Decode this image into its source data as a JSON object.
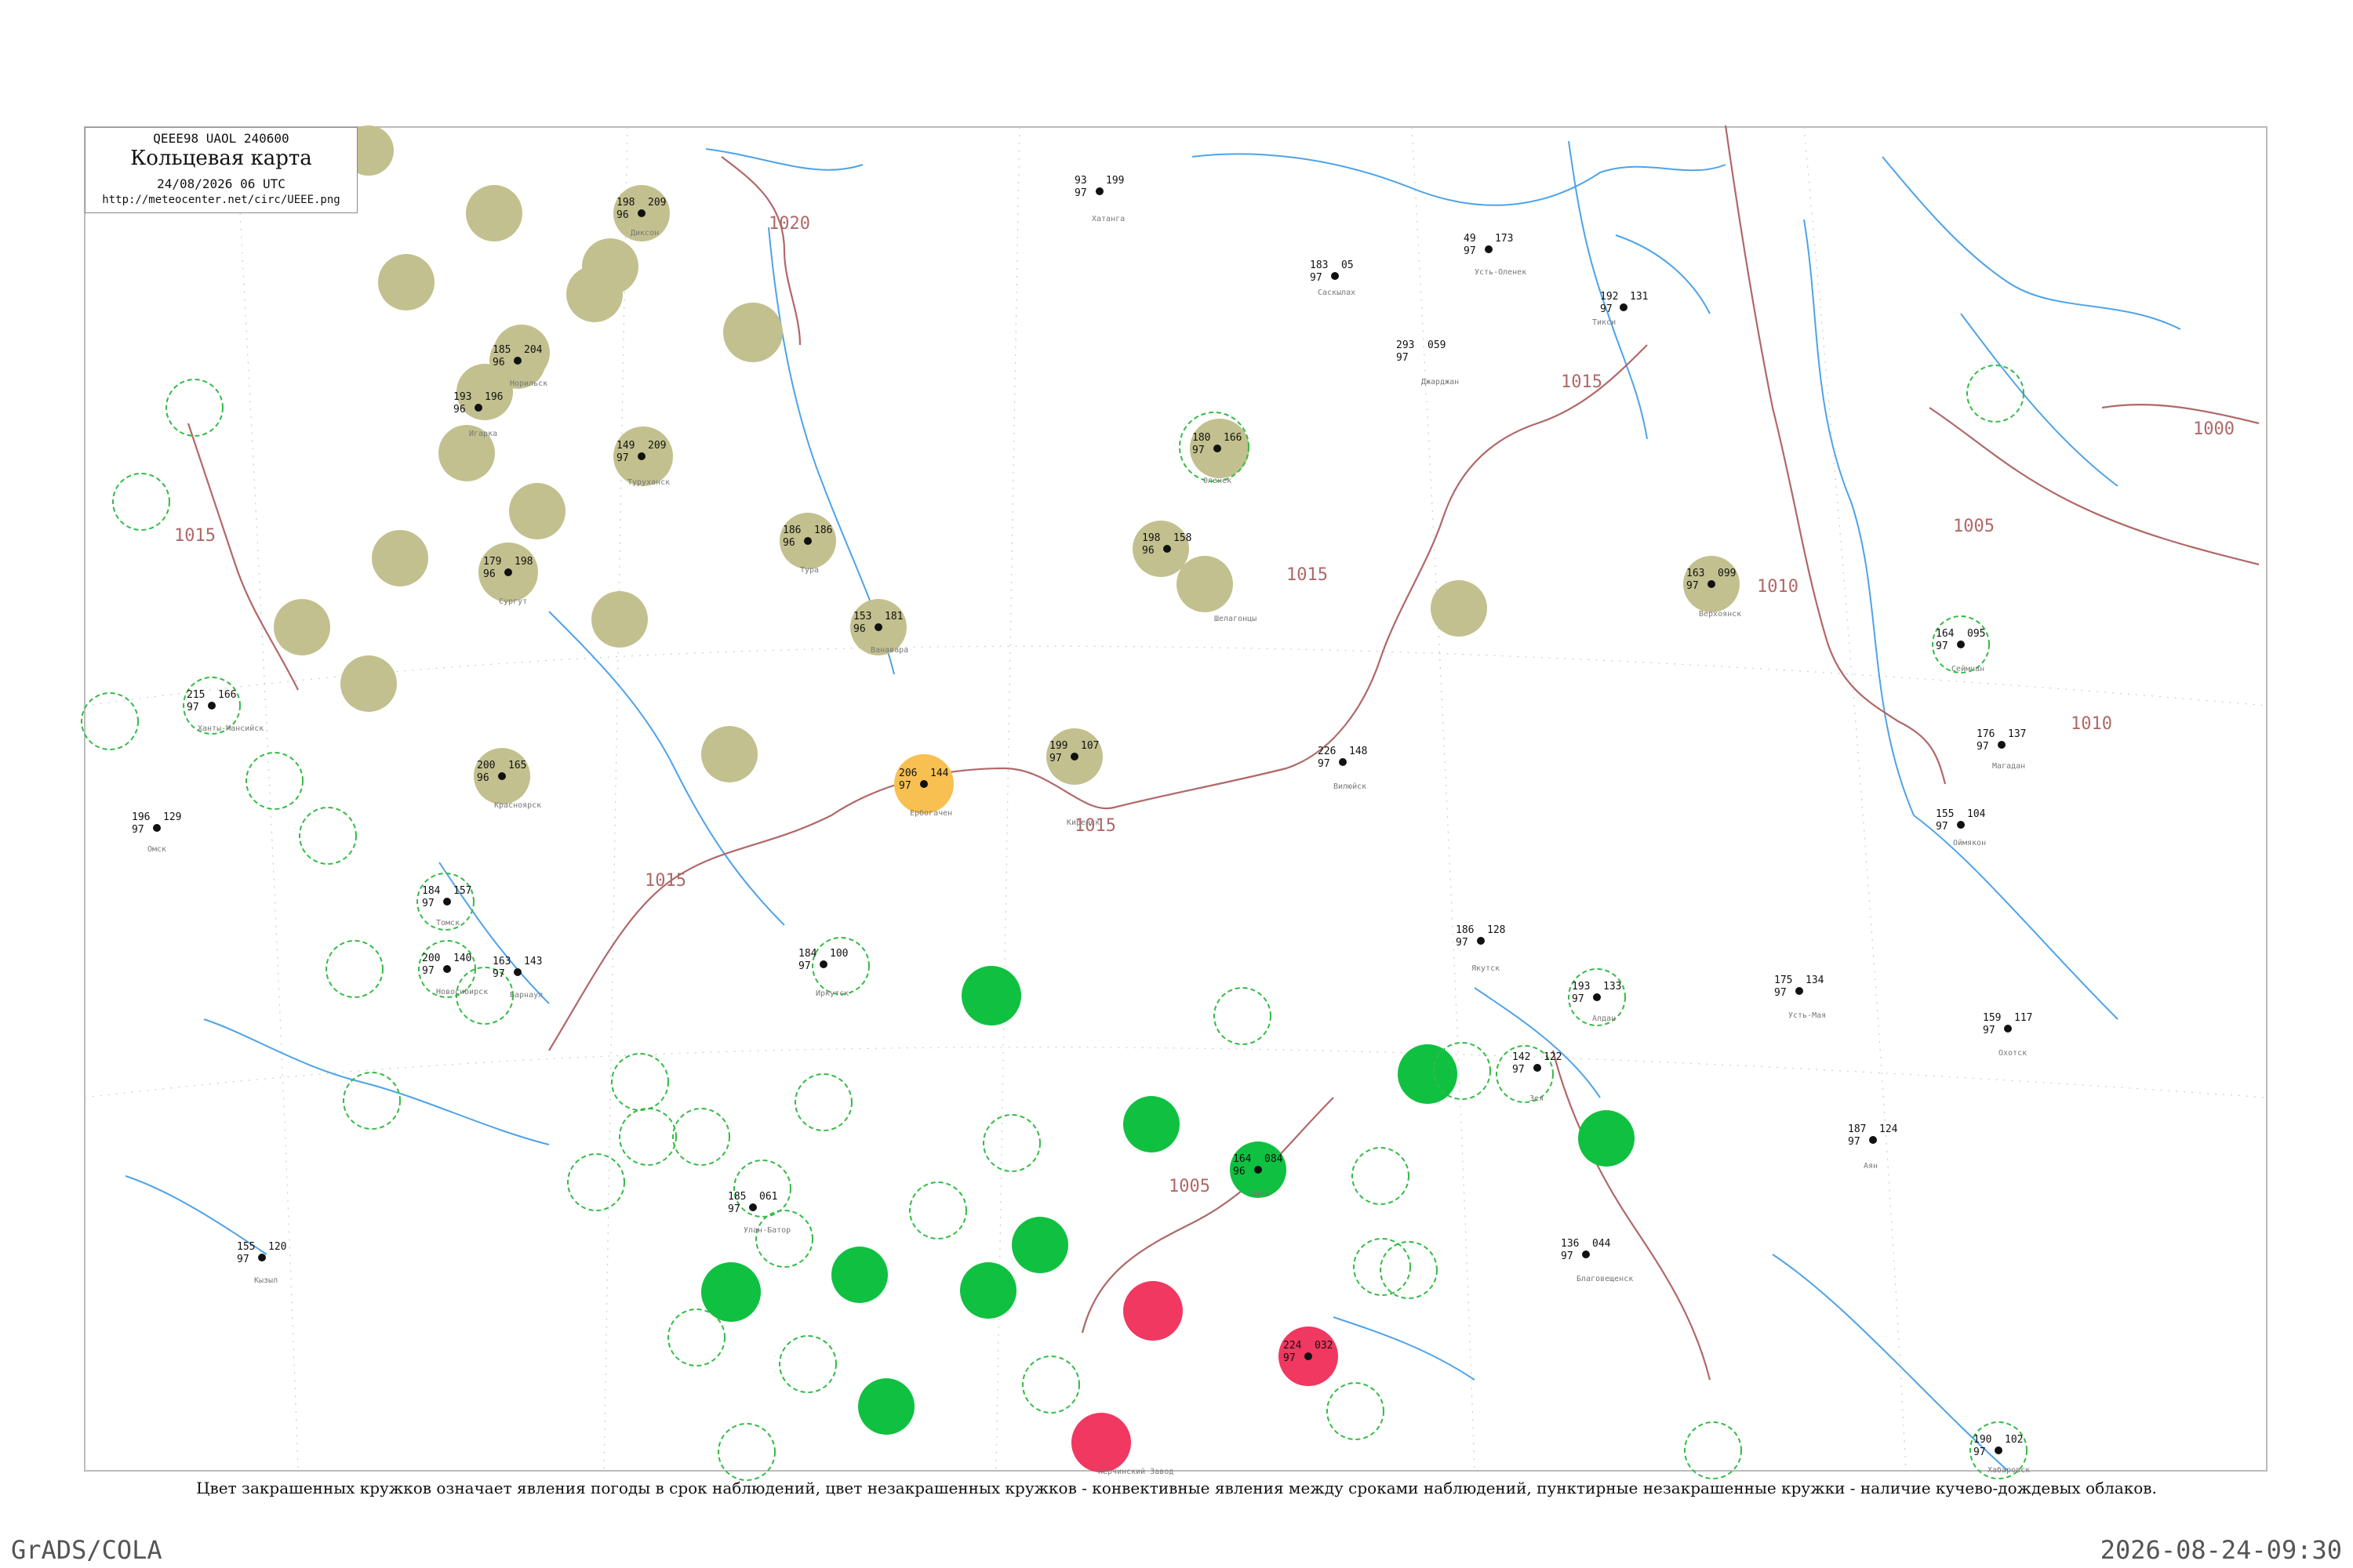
{
  "header": {
    "code": "QEEE98  UAOL  240600",
    "title": "Кольцевая карта",
    "datetime": "24/08/2026 06 UTC",
    "url": "http://meteocenter.net/circ/UEEE.png"
  },
  "caption": "Цвет закрашенных кружков означает явления погоды в срок наблюдений, цвет незакрашенных кружков - конвективные явления между сроками наблюдений, пунктирные незакрашенные кружки - наличие кучево-дождевых облаков.",
  "footer": {
    "software": "GrADS/COLA",
    "generated": "2026-08-24-09:30"
  },
  "colors": {
    "isobar": "#b06868",
    "river": "#4ea3e8",
    "frame": "#bbbbbb",
    "fill_olive": "#c2c08e",
    "fill_green": "#10c040",
    "fill_red": "#f03860",
    "fill_orange": "#f8c050",
    "cb_dashed": "#33bb44"
  },
  "isobars": [
    {
      "value": "1020"
    },
    {
      "value": "1015"
    },
    {
      "value": "1015"
    },
    {
      "value": "1015"
    },
    {
      "value": "1015"
    },
    {
      "value": "1015"
    },
    {
      "value": "1010"
    },
    {
      "value": "1010"
    },
    {
      "value": "1005"
    },
    {
      "value": "1005"
    },
    {
      "value": "1000"
    }
  ],
  "stations": [
    {
      "name": "Тикси",
      "index": "21824",
      "t": "192",
      "td": "97",
      "p": "131"
    },
    {
      "name": "Саскылах",
      "index": "21802",
      "t": "183",
      "td": "97",
      "p": "05"
    },
    {
      "name": "Усть-Оленек",
      "index": "21713",
      "t": "49",
      "td": "97",
      "p": "173"
    },
    {
      "name": "Джарджан",
      "index": "24227",
      "t": "293",
      "td": "97",
      "p": "059"
    },
    {
      "name": "Оленек",
      "index": "24125",
      "t": "180",
      "td": "97",
      "p": "166"
    },
    {
      "name": "Шелагонцы",
      "index": "24329",
      "t": "198",
      "td": "96",
      "p": "158"
    },
    {
      "name": "Туруханск",
      "index": "23472",
      "t": "149",
      "td": "97",
      "p": "209"
    },
    {
      "name": "Тура",
      "index": "24507",
      "t": "186",
      "td": "96",
      "p": "186"
    },
    {
      "name": "Ванавара",
      "index": "24606",
      "t": "153",
      "td": "96",
      "p": "181"
    },
    {
      "name": "Ербогачен",
      "index": "24817",
      "t": "206",
      "td": "97",
      "p": "144"
    },
    {
      "name": "Киренск",
      "index": "30230",
      "t": "199",
      "td": "97",
      "p": "107"
    },
    {
      "name": "Иркутск",
      "index": "30710",
      "t": "184",
      "td": "97",
      "p": "100"
    },
    {
      "name": "Чита",
      "index": "30758",
      "t": "164",
      "td": "96",
      "p": "084"
    },
    {
      "name": "Нерчинский Завод",
      "index": "30781",
      "t": "224",
      "td": "97",
      "p": "032"
    },
    {
      "name": "Благовещенск",
      "index": "31510",
      "t": "136",
      "td": "97",
      "p": "044"
    },
    {
      "name": "Зея",
      "index": "31300",
      "t": "142",
      "td": "97",
      "p": "122"
    },
    {
      "name": "Якутск",
      "index": "24959",
      "t": "186",
      "td": "97",
      "p": "128"
    },
    {
      "name": "Вилюйск",
      "index": "24641",
      "t": "226",
      "td": "97",
      "p": "148"
    },
    {
      "name": "Алдан",
      "index": "31004",
      "t": "193",
      "td": "97",
      "p": "133"
    },
    {
      "name": "Оймякон",
      "index": "24688",
      "t": "155",
      "td": "97",
      "p": "104"
    },
    {
      "name": "Верхоянск",
      "index": "24266",
      "t": "163",
      "td": "97",
      "p": "099"
    },
    {
      "name": "Усть-Мая",
      "index": "31062",
      "t": "175",
      "td": "97",
      "p": "134"
    },
    {
      "name": "Норильск",
      "index": "23078",
      "t": "185",
      "td": "96",
      "p": "204"
    },
    {
      "name": "Хатанга",
      "index": "20891",
      "t": "93",
      "td": "97",
      "p": "199"
    },
    {
      "name": "Диксон",
      "index": "20674",
      "t": "198",
      "td": "96",
      "p": "209"
    },
    {
      "name": "Игарка",
      "index": "23274",
      "t": "193",
      "td": "96",
      "p": "196"
    },
    {
      "name": "Ханты-Мансийск",
      "index": "23933",
      "t": "215",
      "td": "97",
      "p": "166"
    },
    {
      "name": "Сургут",
      "index": "23849",
      "t": "179",
      "td": "96",
      "p": "198"
    },
    {
      "name": "Томск",
      "index": "29430",
      "t": "184",
      "td": "97",
      "p": "157"
    },
    {
      "name": "Новосибирск",
      "index": "29634",
      "t": "200",
      "td": "97",
      "p": "140"
    },
    {
      "name": "Барнаул",
      "index": "29838",
      "t": "163",
      "td": "97",
      "p": "143"
    },
    {
      "name": "Омск",
      "index": "28698",
      "t": "196",
      "td": "97",
      "p": "129"
    },
    {
      "name": "Красноярск",
      "index": "29574",
      "t": "200",
      "td": "96",
      "p": "165"
    },
    {
      "name": "Кызыл",
      "index": "36096",
      "t": "155",
      "td": "97",
      "p": "120"
    },
    {
      "name": "Улан-Батор",
      "index": "44292",
      "t": "185",
      "td": "97",
      "p": "061"
    },
    {
      "name": "Хабаровск",
      "index": "31735",
      "t": "190",
      "td": "97",
      "p": "102"
    },
    {
      "name": "Охотск",
      "index": "31088",
      "t": "159",
      "td": "97",
      "p": "117"
    },
    {
      "name": "Аян",
      "index": "31369",
      "t": "187",
      "td": "97",
      "p": "124"
    },
    {
      "name": "Магадан",
      "index": "25913",
      "t": "176",
      "td": "97",
      "p": "137"
    },
    {
      "name": "Сеймчан",
      "index": "25400",
      "t": "164",
      "td": "97",
      "p": "095"
    }
  ]
}
